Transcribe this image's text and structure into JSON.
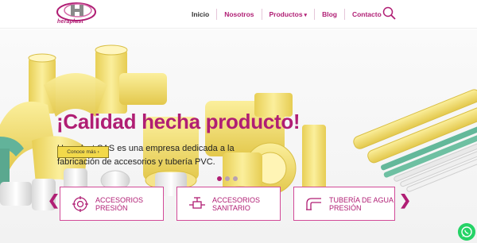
{
  "header": {
    "logo_text": "heraplast",
    "nav": [
      {
        "label": "Inicio"
      },
      {
        "label": "Nosotros"
      },
      {
        "label": "Productos"
      },
      {
        "label": "Blog"
      },
      {
        "label": "Contacto"
      }
    ],
    "search_icon": "search-icon"
  },
  "hero": {
    "title": "¡Calidad hecha producto!",
    "subtitle": "Heraplast SAS es una empresa dedicada a la fabricación de accesorios y tubería PVC.",
    "button_label": "Conoce más",
    "slides": 3,
    "active_slide": 1
  },
  "cards": [
    {
      "label": "Accesorios Presión",
      "icon": "fitting-icon"
    },
    {
      "label": "Accesorios Sanitario",
      "icon": "valve-icon"
    },
    {
      "label": "Tubería de Agua Presión",
      "icon": "pipe-icon"
    }
  ],
  "colors": {
    "brand": "#b01e74",
    "button": "#f3d94a",
    "pipe_yellow": "#f1e07a",
    "pipe_green": "#63b89a",
    "whatsapp": "#25d366"
  }
}
